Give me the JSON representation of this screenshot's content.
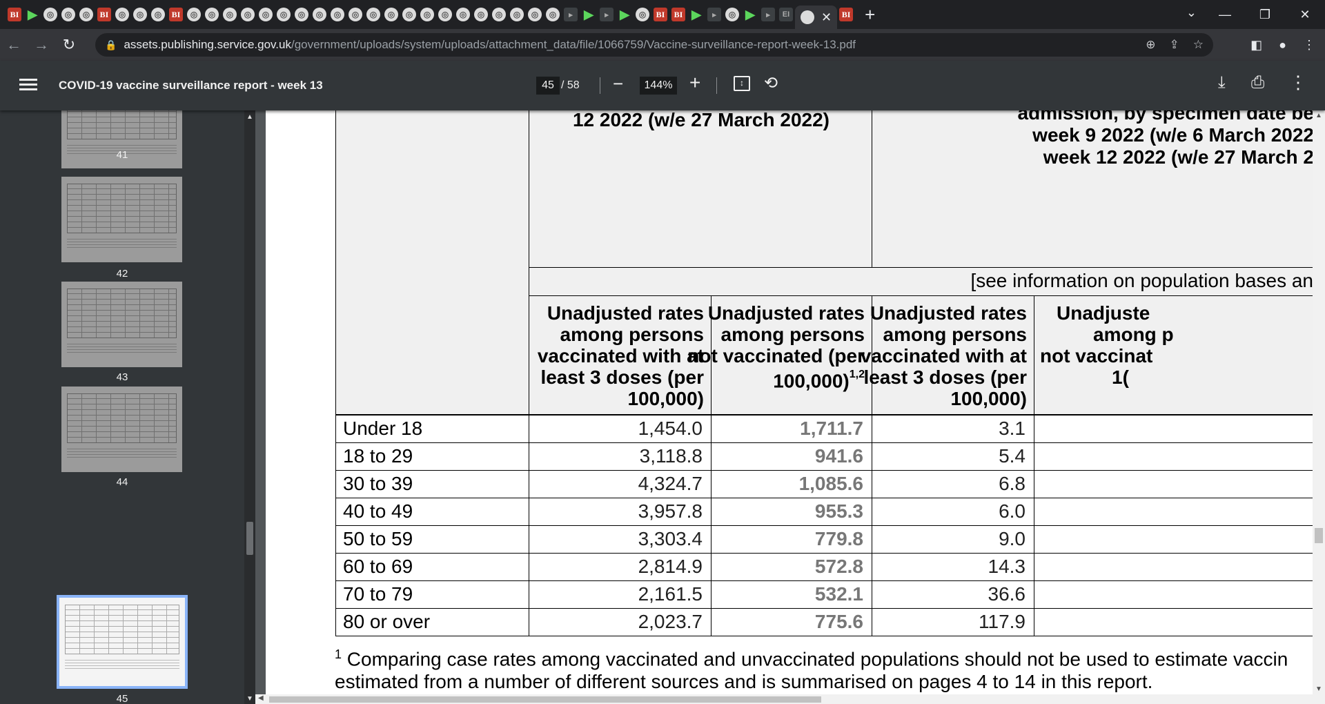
{
  "browser": {
    "favicons": [
      "BI",
      "play",
      "circle",
      "circle",
      "circle",
      "BI",
      "circle",
      "circle",
      "circle",
      "BI",
      "circle",
      "circle",
      "circle",
      "circle",
      "circle",
      "circle",
      "circle",
      "circle",
      "circle",
      "circle",
      "circle",
      "circle",
      "circle",
      "circle",
      "circle",
      "circle",
      "circle",
      "circle",
      "circle",
      "circle",
      "circle",
      "dark",
      "play",
      "dark",
      "play",
      "circle",
      "BI",
      "BI",
      "play",
      "dark",
      "circle",
      "play",
      "dark",
      "EI",
      "g",
      "play",
      "red",
      "dark",
      "dark",
      "dark",
      "yt",
      "y",
      "orange",
      "dark",
      "y",
      "g",
      "dark"
    ],
    "url_host": "assets.publishing.service.gov.uk",
    "url_path": "/government/uploads/system/uploads/attachment_data/file/1066759/Vaccine-surveillance-report-week-13.pdf"
  },
  "pdf": {
    "title": "COVID-19 vaccine surveillance report - week 13",
    "current_page": "45",
    "total_pages": "/ 58",
    "zoom": "144%"
  },
  "sidebar": {
    "thumbnails": [
      {
        "label": "41"
      },
      {
        "label": "42"
      },
      {
        "label": "43"
      },
      {
        "label": "44"
      },
      {
        "label": "45"
      }
    ]
  },
  "table": {
    "group1_title_partial": "12 2022 (w/e 27 March 2022)",
    "group2_title_line1": "admission, by specimen date be",
    "group2_title_line2": "week 9 2022 (w/e 6 March 2022",
    "group2_title_line3": "week 12 2022 (w/e 27 March 2",
    "population_note": "[see information on population bases anc",
    "col1": [
      "Unadjusted rates",
      "among persons",
      "vaccinated with at",
      "least 3 doses (per",
      "100,000)"
    ],
    "col2": [
      "Unadjusted rates",
      "among persons",
      "not vaccinated (per",
      "100,000)",
      "1,2"
    ],
    "col3": [
      "Unadjusted rates",
      "among persons",
      "vaccinated with at",
      "least 3 doses (per",
      "100,000)"
    ],
    "col4": [
      "Unadjuste",
      "among p",
      "not vaccinat",
      "1("
    ],
    "rows": [
      {
        "age": "Under 18",
        "c1": "1,454.0",
        "c2": "1,711.7",
        "c3": "3.1"
      },
      {
        "age": "18 to 29",
        "c1": "3,118.8",
        "c2": "941.6",
        "c3": "5.4"
      },
      {
        "age": "30 to 39",
        "c1": "4,324.7",
        "c2": "1,085.6",
        "c3": "6.8"
      },
      {
        "age": "40 to 49",
        "c1": "3,957.8",
        "c2": "955.3",
        "c3": "6.0"
      },
      {
        "age": "50 to 59",
        "c1": "3,303.4",
        "c2": "779.8",
        "c3": "9.0"
      },
      {
        "age": "60 to 69",
        "c1": "2,814.9",
        "c2": "572.8",
        "c3": "14.3"
      },
      {
        "age": "70 to 79",
        "c1": "2,161.5",
        "c2": "532.1",
        "c3": "36.6"
      },
      {
        "age": "80 or over",
        "c1": "2,023.7",
        "c2": "775.6",
        "c3": "117.9"
      }
    ]
  },
  "footnote": {
    "marker": "1",
    "line1": "Comparing case rates among vaccinated and unvaccinated populations should not be used to estimate vaccin",
    "line2": "estimated from a number of different sources and is summarised on pages 4 to 14 in this report."
  }
}
